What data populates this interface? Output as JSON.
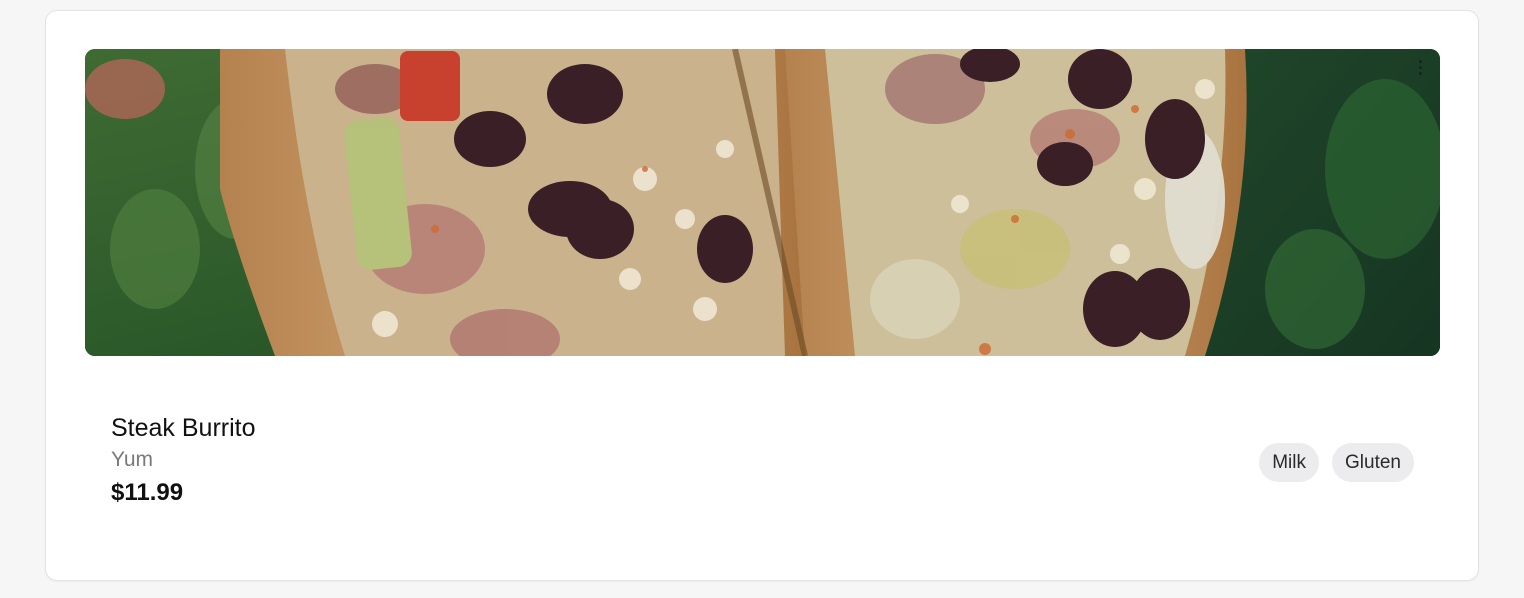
{
  "item": {
    "name": "Steak Burrito",
    "description": "Yum",
    "price": "$11.99",
    "tags": [
      {
        "label": "Milk"
      },
      {
        "label": "Gluten"
      }
    ],
    "image_alt": "Steak Burrito cut in half"
  },
  "colors": {
    "page_bg": "#f6f6f7",
    "card_bg": "#ffffff",
    "tag_bg": "#ececee",
    "muted_text": "#7a7a7a"
  },
  "icons": {
    "more": "more-vertical-icon"
  }
}
